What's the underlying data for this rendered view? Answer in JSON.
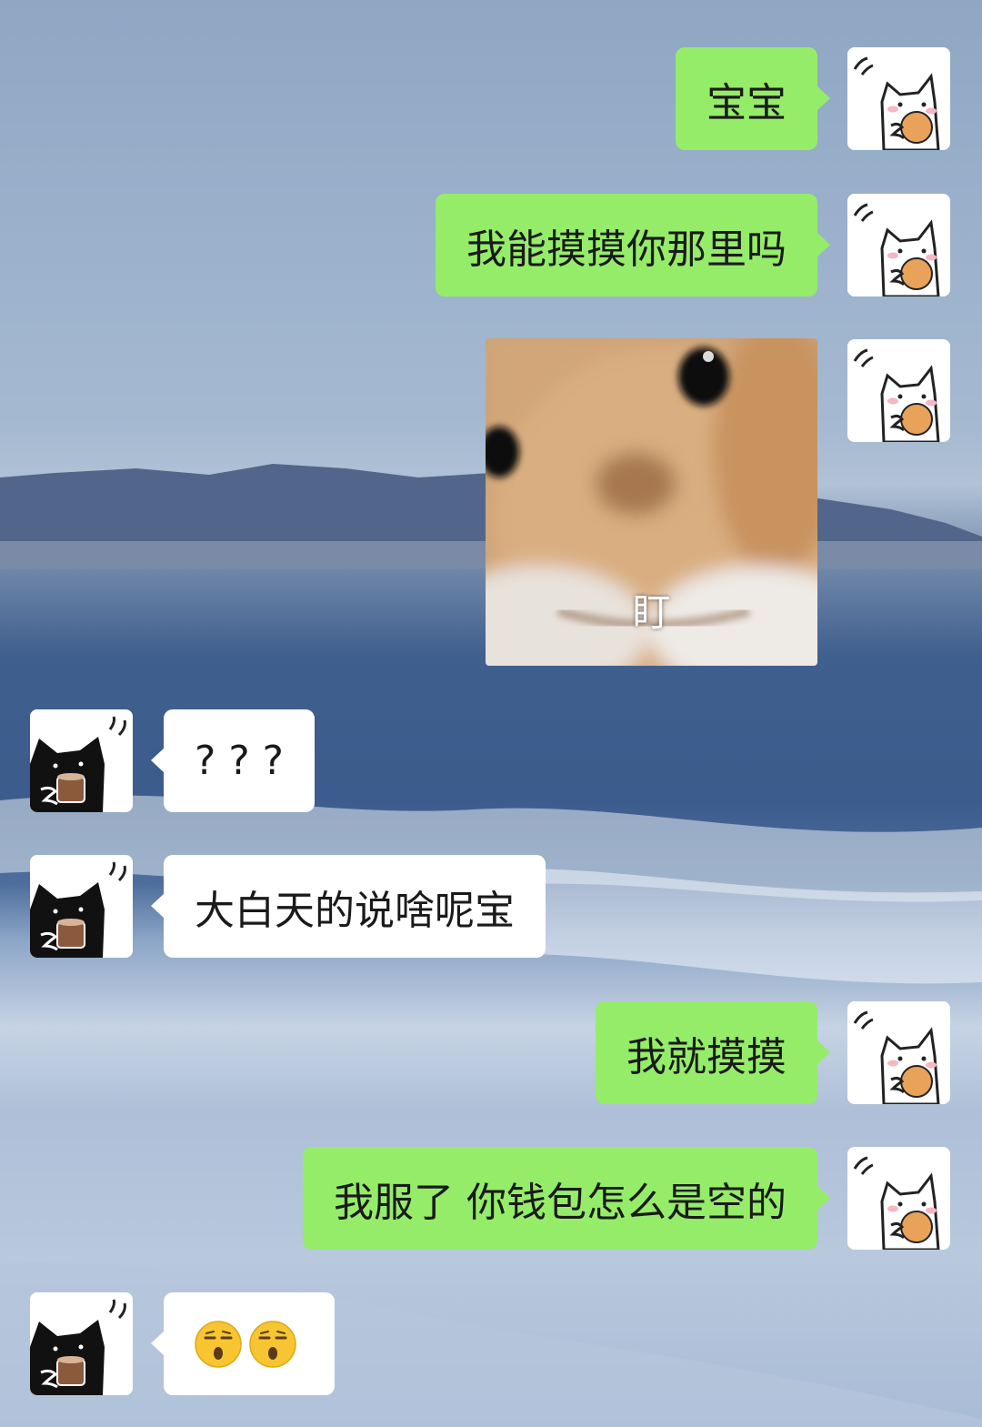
{
  "chat": {
    "messages": [
      {
        "sender": "me",
        "type": "text",
        "text": "宝宝"
      },
      {
        "sender": "me",
        "type": "text",
        "text": "我能摸摸你那里吗"
      },
      {
        "sender": "me",
        "type": "sticker",
        "caption": "盯",
        "subject": "blurry-dog-face"
      },
      {
        "sender": "other",
        "type": "text",
        "text": "? ? ?"
      },
      {
        "sender": "other",
        "type": "text",
        "text": "大白天的说啥呢宝"
      },
      {
        "sender": "me",
        "type": "text",
        "text": "我就摸摸"
      },
      {
        "sender": "me",
        "type": "text",
        "text": "我服了 你钱包怎么是空的"
      },
      {
        "sender": "other",
        "type": "emoji",
        "emoji": [
          "sighing-face",
          "sighing-face"
        ]
      }
    ]
  },
  "avatars": {
    "me": "white-cat-eating-cookie-icon",
    "other": "black-cat-holding-cup-icon"
  },
  "colors": {
    "my_bubble": "#95ec69",
    "other_bubble": "#ffffff"
  },
  "background": "ocean-beach-wallpaper"
}
